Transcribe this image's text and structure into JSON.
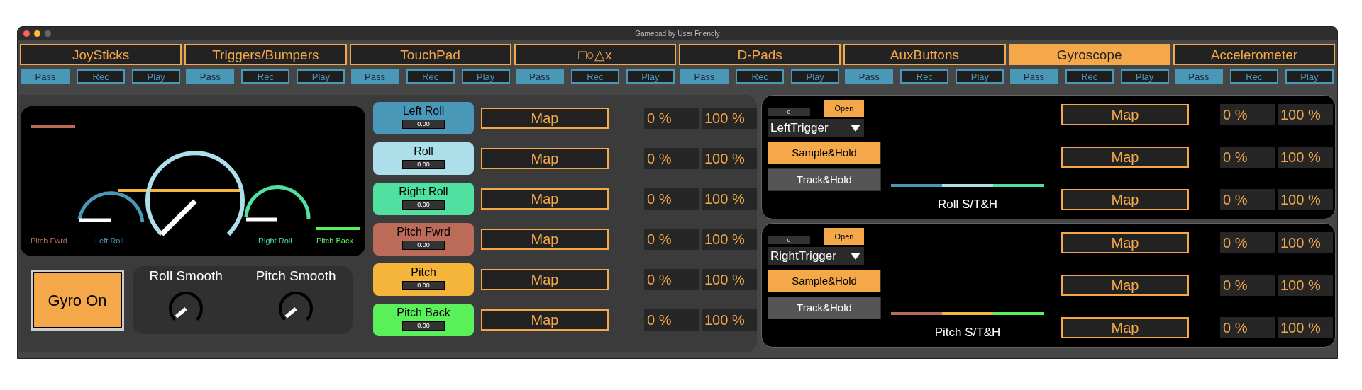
{
  "window": {
    "title": "Gamepad by User Friendly"
  },
  "tabs": [
    {
      "label": "JoySticks",
      "selected": false,
      "buttons": [
        {
          "label": "Pass",
          "on": true
        },
        {
          "label": "Rec",
          "on": false
        },
        {
          "label": "Play",
          "on": false
        }
      ]
    },
    {
      "label": "Triggers/Bumpers",
      "selected": false,
      "buttons": [
        {
          "label": "Pass",
          "on": true
        },
        {
          "label": "Rec",
          "on": false
        },
        {
          "label": "Play",
          "on": false
        }
      ]
    },
    {
      "label": "TouchPad",
      "selected": false,
      "buttons": [
        {
          "label": "Pass",
          "on": true
        },
        {
          "label": "Rec",
          "on": false
        },
        {
          "label": "Play",
          "on": false
        }
      ]
    },
    {
      "label": "□○△x",
      "selected": false,
      "buttons": [
        {
          "label": "Pass",
          "on": true
        },
        {
          "label": "Rec",
          "on": false
        },
        {
          "label": "Play",
          "on": false
        }
      ]
    },
    {
      "label": "D-Pads",
      "selected": false,
      "buttons": [
        {
          "label": "Pass",
          "on": true
        },
        {
          "label": "Rec",
          "on": false
        },
        {
          "label": "Play",
          "on": false
        }
      ]
    },
    {
      "label": "AuxButtons",
      "selected": false,
      "buttons": [
        {
          "label": "Pass",
          "on": true
        },
        {
          "label": "Rec",
          "on": false
        },
        {
          "label": "Play",
          "on": false
        }
      ]
    },
    {
      "label": "Gyroscope",
      "selected": true,
      "buttons": [
        {
          "label": "Pass",
          "on": true
        },
        {
          "label": "Rec",
          "on": false
        },
        {
          "label": "Play",
          "on": false
        }
      ]
    },
    {
      "label": "Accelerometer",
      "selected": false,
      "buttons": [
        {
          "label": "Pass",
          "on": true
        },
        {
          "label": "Rec",
          "on": false
        },
        {
          "label": "Play",
          "on": false
        }
      ]
    }
  ],
  "visualizer": {
    "labels": [
      {
        "text": "Pitch Fwrd",
        "color": "#bc6b58"
      },
      {
        "text": "Left Roll",
        "color": "#4a98b8"
      },
      {
        "text": "Right Roll",
        "color": "#50e0a0"
      },
      {
        "text": "Pitch Back",
        "color": "#5af05a"
      }
    ]
  },
  "gyro_button": {
    "label": "Gyro On",
    "on": true
  },
  "knobs": [
    {
      "label": "Roll Smooth"
    },
    {
      "label": "Pitch Smooth"
    }
  ],
  "channels": [
    {
      "label": "Left Roll",
      "color": "#4a98b8",
      "value": "0.00",
      "map": "Map",
      "min": "0 %",
      "max": "100 %"
    },
    {
      "label": "Roll",
      "color": "#acdfe9",
      "value": "0.00",
      "map": "Map",
      "min": "0 %",
      "max": "100 %"
    },
    {
      "label": "Right Roll",
      "color": "#50e0a0",
      "value": "0.00",
      "map": "Map",
      "min": "0 %",
      "max": "100 %"
    },
    {
      "label": "Pitch Fwrd",
      "color": "#bc6b58",
      "value": "0.00",
      "map": "Map",
      "min": "0 %",
      "max": "100 %"
    },
    {
      "label": "Pitch",
      "color": "#f5b43a",
      "value": "0.00",
      "map": "Map",
      "min": "0 %",
      "max": "100 %"
    },
    {
      "label": "Pitch Back",
      "color": "#5af05a",
      "value": "0.00",
      "map": "Map",
      "min": "0 %",
      "max": "100 %"
    }
  ],
  "hold_sections": [
    {
      "counter": "0",
      "open": "Open",
      "source": "LeftTrigger",
      "modes": [
        {
          "label": "Sample&Hold",
          "selected": true
        },
        {
          "label": "Track&Hold",
          "selected": false
        }
      ],
      "bar_segments": [
        {
          "color": "#4a98b8"
        },
        {
          "color": "#acdfe9"
        },
        {
          "color": "#50e0a0"
        }
      ],
      "label": "Roll S/T&H",
      "rows": [
        {
          "map": "Map",
          "min": "0 %",
          "max": "100 %"
        },
        {
          "map": "Map",
          "min": "0 %",
          "max": "100 %"
        },
        {
          "map": "Map",
          "min": "0 %",
          "max": "100 %"
        }
      ]
    },
    {
      "counter": "0",
      "open": "Open",
      "source": "RightTrigger",
      "modes": [
        {
          "label": "Sample&Hold",
          "selected": true
        },
        {
          "label": "Track&Hold",
          "selected": false
        }
      ],
      "bar_segments": [
        {
          "color": "#bc6b58"
        },
        {
          "color": "#f5b43a"
        },
        {
          "color": "#5af05a"
        }
      ],
      "label": "Pitch S/T&H",
      "rows": [
        {
          "map": "Map",
          "min": "0 %",
          "max": "100 %"
        },
        {
          "map": "Map",
          "min": "0 %",
          "max": "100 %"
        },
        {
          "map": "Map",
          "min": "0 %",
          "max": "100 %"
        }
      ]
    }
  ]
}
